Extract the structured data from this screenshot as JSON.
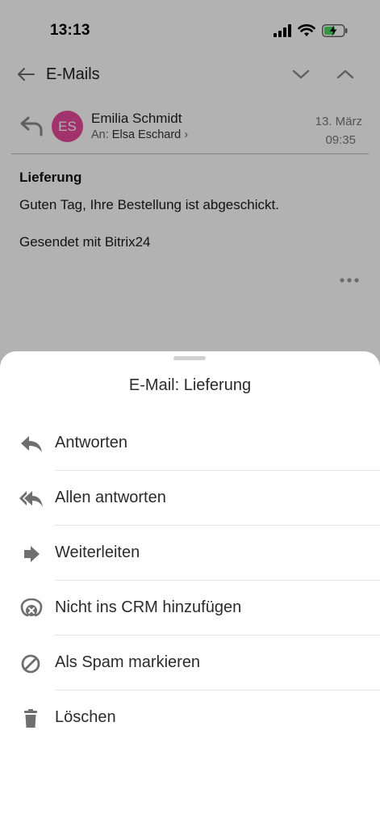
{
  "status_bar": {
    "time": "13:13"
  },
  "nav": {
    "title": "E-Mails"
  },
  "mail": {
    "avatar_initials": "ES",
    "avatar_color": "#e8489b",
    "sender": "Emilia Schmidt",
    "to_prefix": "An:",
    "to_name": "Elsa Eschard",
    "date": "13. März",
    "time": "09:35",
    "subject": "Lieferung",
    "body": "Guten Tag, Ihre Bestellung ist abgeschickt.",
    "signature": "Gesendet mit Bitrix24"
  },
  "sheet": {
    "title": "E-Mail: Lieferung",
    "items": [
      {
        "label": "Antworten",
        "icon": "reply-icon"
      },
      {
        "label": "Allen antworten",
        "icon": "reply-all-icon"
      },
      {
        "label": "Weiterleiten",
        "icon": "forward-icon"
      },
      {
        "label": "Nicht ins CRM hinzufügen",
        "icon": "crm-exclude-icon"
      },
      {
        "label": "Als Spam markieren",
        "icon": "spam-icon"
      },
      {
        "label": "Löschen",
        "icon": "trash-icon"
      }
    ]
  },
  "colors": {
    "accent_avatar": "#e8489b",
    "overlay": "rgba(0,0,0,0.30)",
    "icon_gray": "#6f6f6f"
  }
}
